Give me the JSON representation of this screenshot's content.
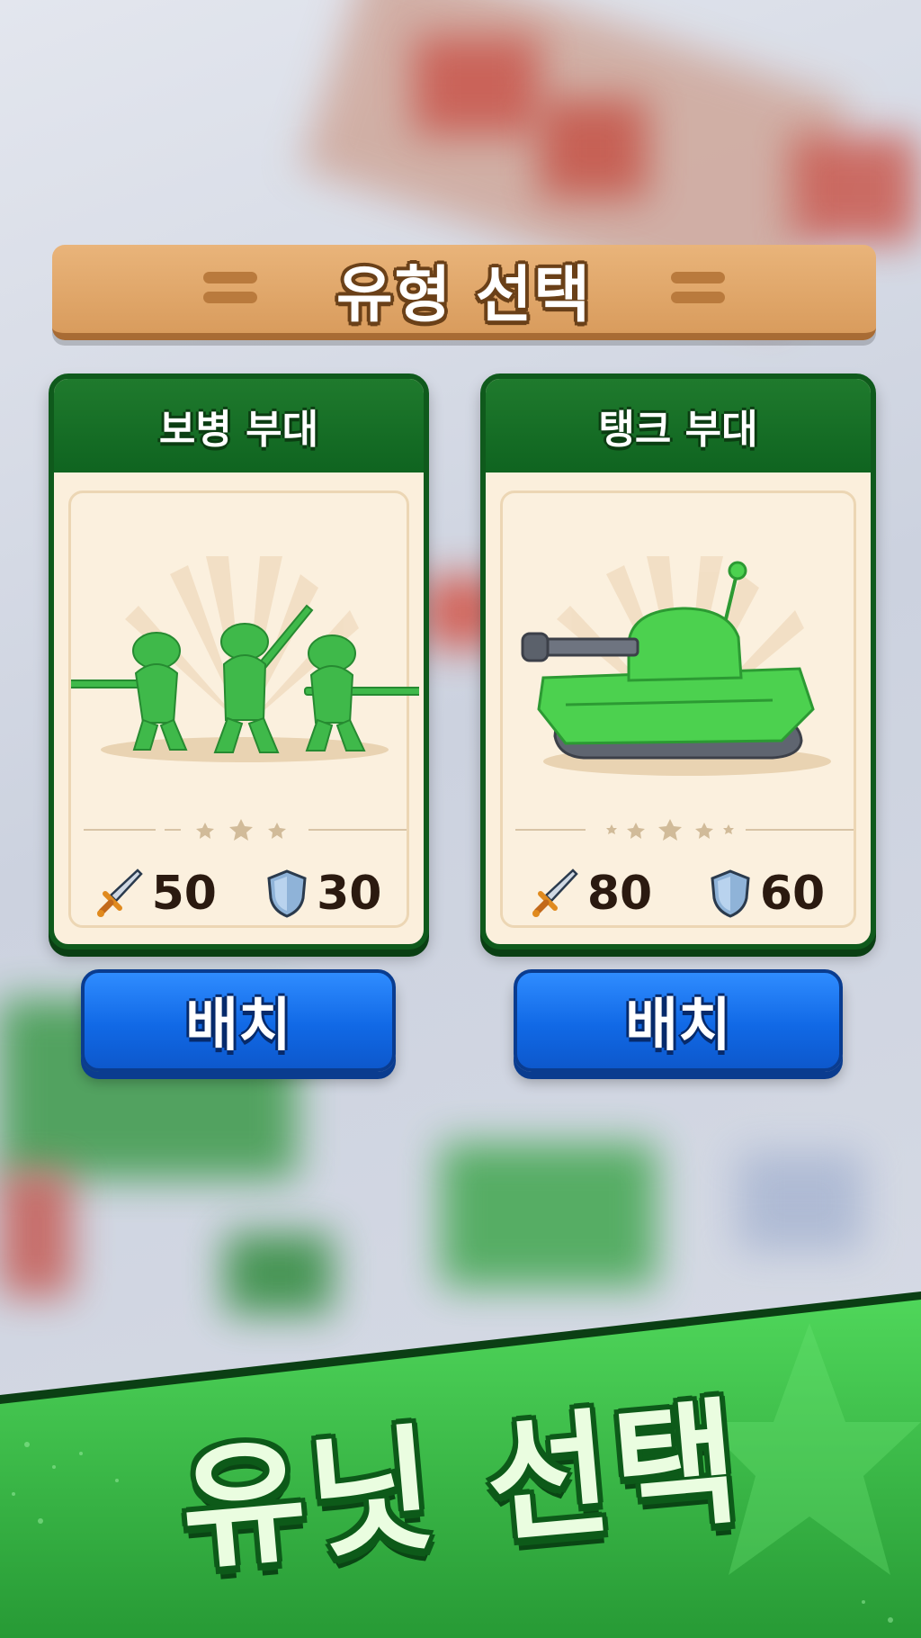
{
  "screen_title": "유형 선택",
  "cards": [
    {
      "title": "보병 부대",
      "attack": "50",
      "defense": "30",
      "attack_icon": "sword-icon",
      "defense_icon": "shield-icon",
      "deploy_label": "배치"
    },
    {
      "title": "탱크 부대",
      "attack": "80",
      "defense": "60",
      "attack_icon": "sword-icon",
      "defense_icon": "shield-icon",
      "deploy_label": "배치"
    }
  ],
  "banner": "유닛 선택",
  "colors": {
    "card_header": "#1f7a2d",
    "card_body": "#fbefdc",
    "button": "#1169e6",
    "header_banner": "#e2a96b",
    "ribbon": "#3cc04a"
  }
}
